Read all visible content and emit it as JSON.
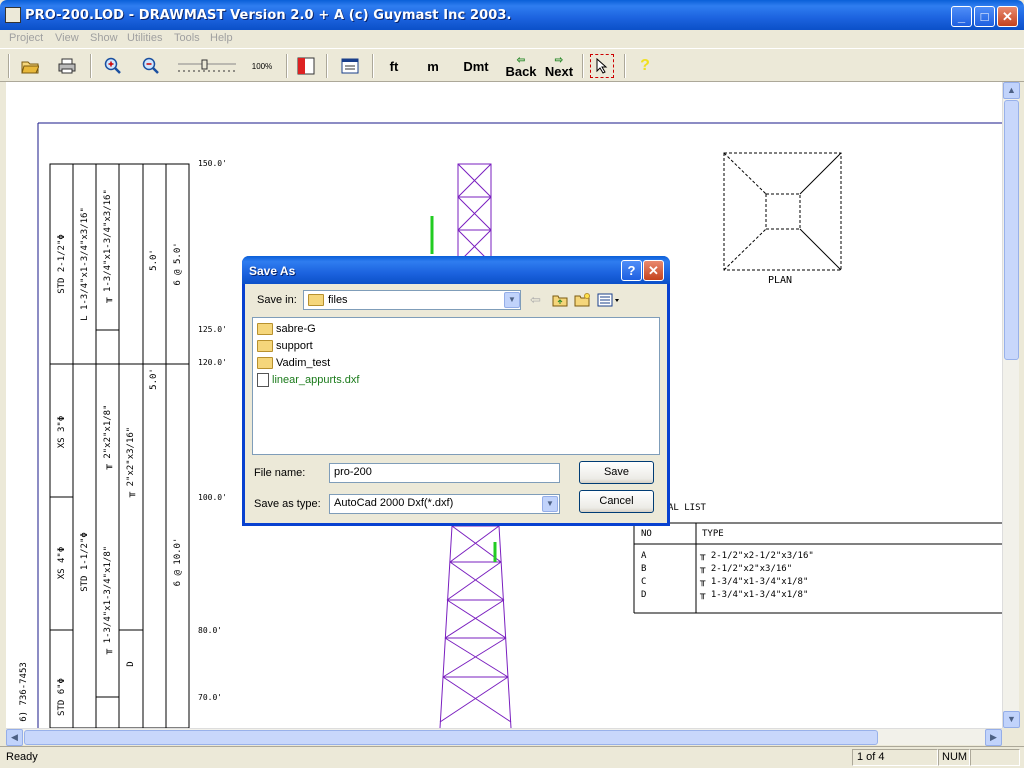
{
  "window": {
    "title": "PRO-200.LOD - DRAWMAST Version 2.0 + A (c) Guymast Inc 2003."
  },
  "menu": [
    "Project",
    "View",
    "Show",
    "Utilities",
    "Tools",
    "Help"
  ],
  "toolbar": {
    "zoom_level": "100%",
    "ft": "ft",
    "m": "m",
    "dmt": "Dmt",
    "back": "Back",
    "next": "Next",
    "help": "?"
  },
  "drawing": {
    "elevations": [
      "150.0'",
      "125.0'",
      "120.0'",
      "100.0'",
      "80.0'",
      "70.0'"
    ],
    "col1": [
      "STD 2-1/2\"Φ",
      "XS 3\"Φ",
      "XS 4\"Φ",
      "STD 6\"Φ"
    ],
    "col2": [
      "L 1-3/4\"x1-3/4\"x3/16\"",
      "STD 1-1/2\"Φ"
    ],
    "col3": [
      "╥ 1-3/4\"x1-3/4\"x3/16\"",
      "╥ 2\"x2\"x1/8\"",
      "╥ 1-3/4\"x1-3/4\"x1/8\""
    ],
    "col4": [
      "╥ 2\"x2\"x3/16\"",
      "D"
    ],
    "col5": [
      "5.0'",
      "5.0'"
    ],
    "col6": [
      "6 @ 5.0'",
      "6 @ 10.0'"
    ],
    "phone": "6) 736-7453",
    "plan_label": "PLAN",
    "material_list_title": "AL LIST",
    "material_headers": [
      "NO",
      "TYPE"
    ],
    "materials": [
      {
        "no": "A",
        "type": "╥ 2-1/2\"x2-1/2\"x3/16\""
      },
      {
        "no": "B",
        "type": "╥ 2-1/2\"x2\"x3/16\""
      },
      {
        "no": "C",
        "type": "╥ 1-3/4\"x1-3/4\"x1/8\""
      },
      {
        "no": "D",
        "type": "╥ 1-3/4\"x1-3/4\"x1/8\""
      }
    ]
  },
  "dialog": {
    "title": "Save As",
    "save_in_label": "Save in:",
    "save_in_value": "files",
    "items": [
      {
        "name": "sabre-G",
        "kind": "folder"
      },
      {
        "name": "support",
        "kind": "folder"
      },
      {
        "name": "Vadim_test",
        "kind": "folder"
      },
      {
        "name": "linear_appurts.dxf",
        "kind": "file"
      }
    ],
    "file_name_label": "File name:",
    "file_name_value": "pro-200",
    "save_type_label": "Save as type:",
    "save_type_value": "AutoCad 2000 Dxf(*.dxf)",
    "save_button": "Save",
    "cancel_button": "Cancel"
  },
  "status": {
    "text": "Ready",
    "page": "1 of 4",
    "num": "NUM"
  },
  "colors": {
    "tower": "#7a1fbf",
    "accent": "#0a5fd8",
    "file_text": "#1a7a1a",
    "highlight": "#22cc22"
  }
}
